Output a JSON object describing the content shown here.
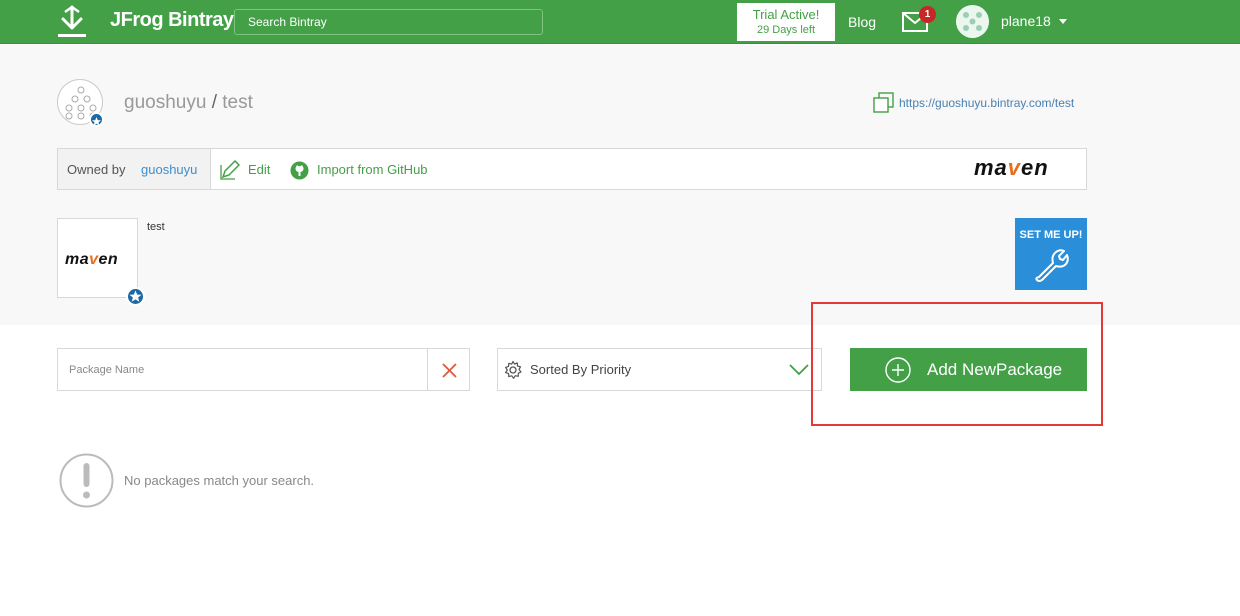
{
  "header": {
    "brand": "JFrog Bintray",
    "search_placeholder": "Search Bintray",
    "trial_title": "Trial Active!",
    "trial_days": "29 Days left",
    "blog_label": "Blog",
    "mail_count": "1",
    "username": "plane18"
  },
  "repo": {
    "owner": "guoshuyu",
    "separator": "/",
    "name": "test",
    "url": "https://guoshuyu.bintray.com/test",
    "owned_by_label": "Owned by",
    "owned_by_link": "guoshuyu",
    "edit_label": "Edit",
    "import_label": "Import from GitHub",
    "type_logo_prefix": "ma",
    "type_logo_v": "v",
    "type_logo_suffix": "en",
    "description": "test",
    "setmeup_label": "SET ME UP!"
  },
  "filters": {
    "package_placeholder": "Package Name",
    "sort_label": "Sorted By Priority",
    "add_button_label": "Add NewPackage"
  },
  "empty_state": {
    "message": "No packages match your search."
  },
  "colors": {
    "brand_green": "#43a047",
    "highlight_red": "#e53935",
    "setmeup_blue": "#2a8fd8",
    "star_blue": "#1b6aa6"
  },
  "icons": [
    "download-logo-icon",
    "mail-icon",
    "copy-icon",
    "edit-icon",
    "github-icon",
    "star-icon",
    "wrench-icon",
    "close-icon",
    "gear-icon",
    "chevron-down-icon",
    "plus-circle-icon",
    "warning-icon"
  ]
}
